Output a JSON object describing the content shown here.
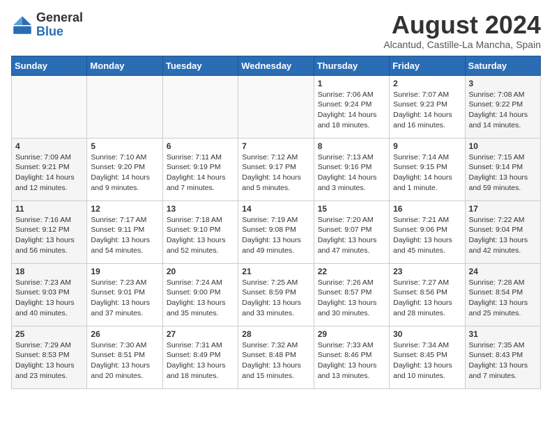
{
  "header": {
    "logo_line1": "General",
    "logo_line2": "Blue",
    "month_year": "August 2024",
    "location": "Alcantud, Castille-La Mancha, Spain"
  },
  "days_of_week": [
    "Sunday",
    "Monday",
    "Tuesday",
    "Wednesday",
    "Thursday",
    "Friday",
    "Saturday"
  ],
  "weeks": [
    [
      {
        "day": "",
        "info": ""
      },
      {
        "day": "",
        "info": ""
      },
      {
        "day": "",
        "info": ""
      },
      {
        "day": "",
        "info": ""
      },
      {
        "day": "1",
        "info": "Sunrise: 7:06 AM\nSunset: 9:24 PM\nDaylight: 14 hours\nand 18 minutes."
      },
      {
        "day": "2",
        "info": "Sunrise: 7:07 AM\nSunset: 9:23 PM\nDaylight: 14 hours\nand 16 minutes."
      },
      {
        "day": "3",
        "info": "Sunrise: 7:08 AM\nSunset: 9:22 PM\nDaylight: 14 hours\nand 14 minutes."
      }
    ],
    [
      {
        "day": "4",
        "info": "Sunrise: 7:09 AM\nSunset: 9:21 PM\nDaylight: 14 hours\nand 12 minutes."
      },
      {
        "day": "5",
        "info": "Sunrise: 7:10 AM\nSunset: 9:20 PM\nDaylight: 14 hours\nand 9 minutes."
      },
      {
        "day": "6",
        "info": "Sunrise: 7:11 AM\nSunset: 9:19 PM\nDaylight: 14 hours\nand 7 minutes."
      },
      {
        "day": "7",
        "info": "Sunrise: 7:12 AM\nSunset: 9:17 PM\nDaylight: 14 hours\nand 5 minutes."
      },
      {
        "day": "8",
        "info": "Sunrise: 7:13 AM\nSunset: 9:16 PM\nDaylight: 14 hours\nand 3 minutes."
      },
      {
        "day": "9",
        "info": "Sunrise: 7:14 AM\nSunset: 9:15 PM\nDaylight: 14 hours\nand 1 minute."
      },
      {
        "day": "10",
        "info": "Sunrise: 7:15 AM\nSunset: 9:14 PM\nDaylight: 13 hours\nand 59 minutes."
      }
    ],
    [
      {
        "day": "11",
        "info": "Sunrise: 7:16 AM\nSunset: 9:12 PM\nDaylight: 13 hours\nand 56 minutes."
      },
      {
        "day": "12",
        "info": "Sunrise: 7:17 AM\nSunset: 9:11 PM\nDaylight: 13 hours\nand 54 minutes."
      },
      {
        "day": "13",
        "info": "Sunrise: 7:18 AM\nSunset: 9:10 PM\nDaylight: 13 hours\nand 52 minutes."
      },
      {
        "day": "14",
        "info": "Sunrise: 7:19 AM\nSunset: 9:08 PM\nDaylight: 13 hours\nand 49 minutes."
      },
      {
        "day": "15",
        "info": "Sunrise: 7:20 AM\nSunset: 9:07 PM\nDaylight: 13 hours\nand 47 minutes."
      },
      {
        "day": "16",
        "info": "Sunrise: 7:21 AM\nSunset: 9:06 PM\nDaylight: 13 hours\nand 45 minutes."
      },
      {
        "day": "17",
        "info": "Sunrise: 7:22 AM\nSunset: 9:04 PM\nDaylight: 13 hours\nand 42 minutes."
      }
    ],
    [
      {
        "day": "18",
        "info": "Sunrise: 7:23 AM\nSunset: 9:03 PM\nDaylight: 13 hours\nand 40 minutes."
      },
      {
        "day": "19",
        "info": "Sunrise: 7:23 AM\nSunset: 9:01 PM\nDaylight: 13 hours\nand 37 minutes."
      },
      {
        "day": "20",
        "info": "Sunrise: 7:24 AM\nSunset: 9:00 PM\nDaylight: 13 hours\nand 35 minutes."
      },
      {
        "day": "21",
        "info": "Sunrise: 7:25 AM\nSunset: 8:59 PM\nDaylight: 13 hours\nand 33 minutes."
      },
      {
        "day": "22",
        "info": "Sunrise: 7:26 AM\nSunset: 8:57 PM\nDaylight: 13 hours\nand 30 minutes."
      },
      {
        "day": "23",
        "info": "Sunrise: 7:27 AM\nSunset: 8:56 PM\nDaylight: 13 hours\nand 28 minutes."
      },
      {
        "day": "24",
        "info": "Sunrise: 7:28 AM\nSunset: 8:54 PM\nDaylight: 13 hours\nand 25 minutes."
      }
    ],
    [
      {
        "day": "25",
        "info": "Sunrise: 7:29 AM\nSunset: 8:53 PM\nDaylight: 13 hours\nand 23 minutes."
      },
      {
        "day": "26",
        "info": "Sunrise: 7:30 AM\nSunset: 8:51 PM\nDaylight: 13 hours\nand 20 minutes."
      },
      {
        "day": "27",
        "info": "Sunrise: 7:31 AM\nSunset: 8:49 PM\nDaylight: 13 hours\nand 18 minutes."
      },
      {
        "day": "28",
        "info": "Sunrise: 7:32 AM\nSunset: 8:48 PM\nDaylight: 13 hours\nand 15 minutes."
      },
      {
        "day": "29",
        "info": "Sunrise: 7:33 AM\nSunset: 8:46 PM\nDaylight: 13 hours\nand 13 minutes."
      },
      {
        "day": "30",
        "info": "Sunrise: 7:34 AM\nSunset: 8:45 PM\nDaylight: 13 hours\nand 10 minutes."
      },
      {
        "day": "31",
        "info": "Sunrise: 7:35 AM\nSunset: 8:43 PM\nDaylight: 13 hours\nand 7 minutes."
      }
    ]
  ]
}
